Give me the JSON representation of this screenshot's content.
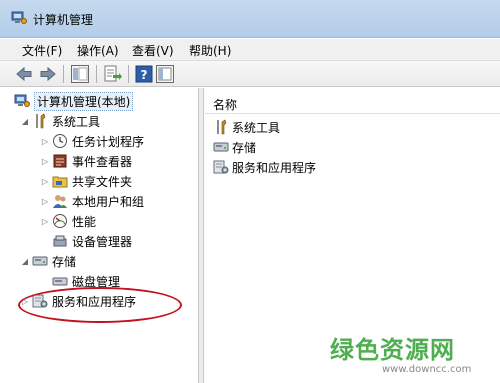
{
  "window": {
    "title": "计算机管理"
  },
  "menu": [
    {
      "label": "文件(F)"
    },
    {
      "label": "操作(A)"
    },
    {
      "label": "查看(V)"
    },
    {
      "label": "帮助(H)"
    }
  ],
  "toolbar": {
    "buttons": [
      "back-icon",
      "forward-icon",
      "show-hide-tree-icon",
      "export-list-icon",
      "help-icon",
      "properties-icon"
    ]
  },
  "tree": {
    "root": {
      "label": "计算机管理(本地)",
      "icon": "computer-management-icon"
    },
    "groups": [
      {
        "label": "系统工具",
        "icon": "tools-icon",
        "expanded": true,
        "children": [
          {
            "label": "任务计划程序",
            "icon": "clock-icon"
          },
          {
            "label": "事件查看器",
            "icon": "event-viewer-icon"
          },
          {
            "label": "共享文件夹",
            "icon": "shared-folder-icon"
          },
          {
            "label": "本地用户和组",
            "icon": "users-icon"
          },
          {
            "label": "性能",
            "icon": "performance-icon"
          },
          {
            "label": "设备管理器",
            "icon": "device-manager-icon"
          }
        ]
      },
      {
        "label": "存储",
        "icon": "storage-icon",
        "expanded": true,
        "children": [
          {
            "label": "磁盘管理",
            "icon": "disk-icon"
          }
        ]
      },
      {
        "label": "服务和应用程序",
        "icon": "services-icon",
        "expanded": false
      }
    ]
  },
  "list": {
    "column_header": "名称",
    "items": [
      {
        "label": "系统工具",
        "icon": "tools-icon"
      },
      {
        "label": "存储",
        "icon": "storage-icon"
      },
      {
        "label": "服务和应用程序",
        "icon": "services-icon"
      }
    ]
  },
  "annotation": {
    "color": "#c1121f"
  },
  "watermark": {
    "main": "绿色资源网",
    "sub": "www.downcc.com"
  }
}
